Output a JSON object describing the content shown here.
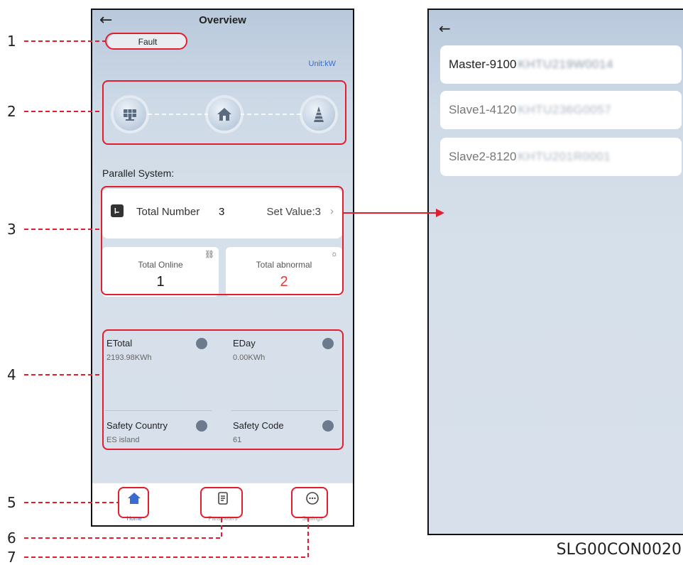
{
  "overview": {
    "title": "Overview",
    "status_badge": "Fault",
    "unit": "Unit:kW",
    "flow_icons": [
      "solar-panel-icon",
      "home-icon",
      "grid-tower-icon"
    ],
    "section_title": "Parallel System:",
    "total_number": {
      "label": "Total Number",
      "value": "3",
      "set_value": "Set Value:3"
    },
    "total_online": {
      "label": "Total Online",
      "value": "1"
    },
    "total_abnormal": {
      "label": "Total abnormal",
      "value": "2"
    },
    "stats": [
      {
        "name": "ETotal",
        "value": "2193.98KWh",
        "icon": "energy-total-icon"
      },
      {
        "name": "EDay",
        "value": "0.00KWh",
        "icon": "energy-day-icon"
      },
      {
        "name": "Safety Country",
        "value": "ES island",
        "icon": "shield-check-icon"
      },
      {
        "name": "Safety Code",
        "value": "61",
        "icon": "shield-code-icon"
      }
    ],
    "nav": [
      {
        "label": "Home",
        "icon": "home-icon"
      },
      {
        "label": "Parameters",
        "icon": "document-icon"
      },
      {
        "label": "Settings",
        "icon": "more-icon"
      }
    ]
  },
  "device_list": {
    "items": [
      {
        "name": "Master-9100",
        "serial": "KHTU219W0014"
      },
      {
        "name": "Slave1-4120",
        "serial": "KHTU236G0057"
      },
      {
        "name": "Slave2-8120",
        "serial": "KHTU201R0001"
      }
    ]
  },
  "callouts": [
    "1",
    "2",
    "3",
    "4",
    "5",
    "6",
    "7"
  ],
  "caption": "SLG00CON0020",
  "colors": {
    "highlight": "#e11d2e",
    "accent": "#3a6bd1",
    "abnormal": "#e53935"
  }
}
